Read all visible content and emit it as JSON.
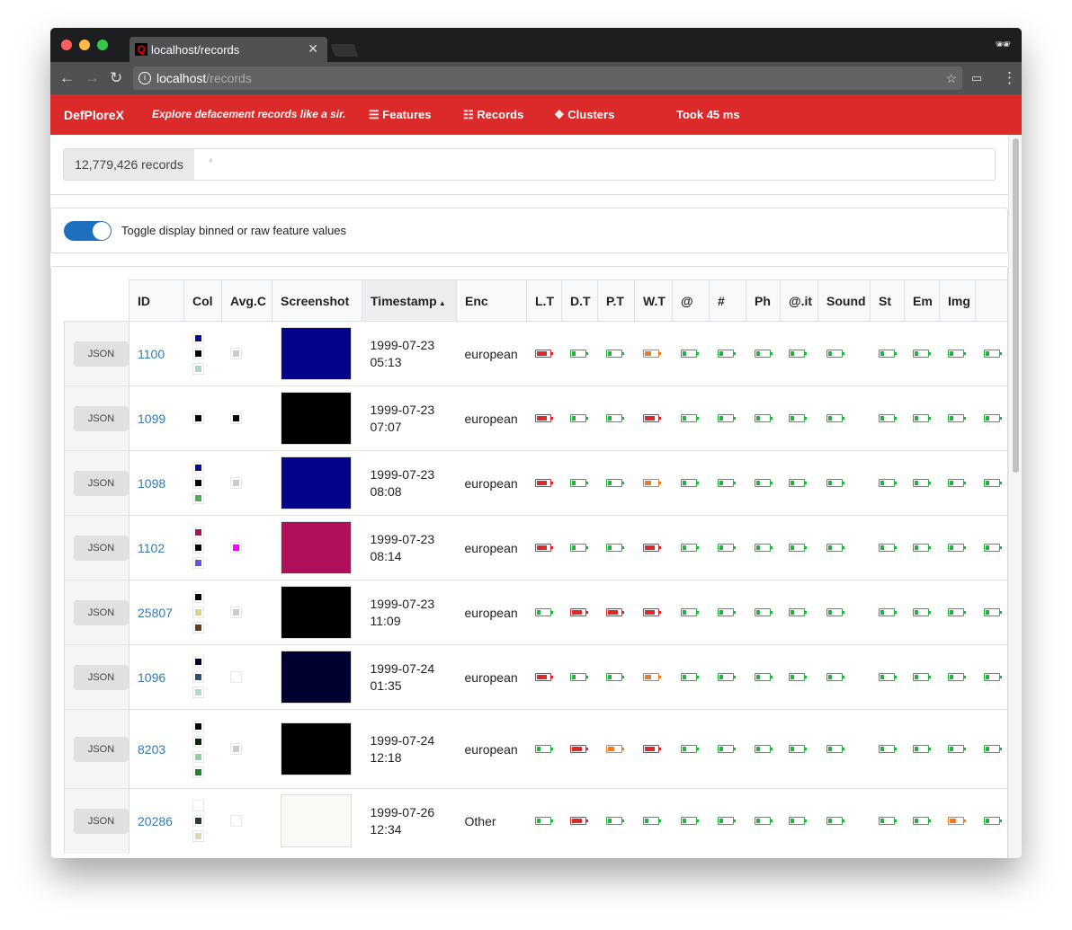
{
  "browser": {
    "tab_title": "localhost/records",
    "url_host": "localhost",
    "url_path": "/records"
  },
  "nav": {
    "brand": "DefPloreX",
    "tagline": "Explore defacement records like a sir.",
    "features": "Features",
    "records": "Records",
    "clusters": "Clusters",
    "took": "Took 45 ms"
  },
  "search": {
    "count": "12,779,426 records",
    "query": "*"
  },
  "toggle": {
    "label": "Toggle display binned or raw feature values",
    "on": true
  },
  "colors": {
    "accent": "#dc2a2a",
    "low": "#22b33c",
    "mid": "#f07a1e",
    "high": "#dc2a2a",
    "link": "#337ab7"
  },
  "table": {
    "headers": [
      "ID",
      "Col",
      "Avg.C",
      "Screenshot",
      "Timestamp",
      "Enc",
      "L.T",
      "D.T",
      "P.T",
      "W.T",
      "@",
      "#",
      "Ph",
      "@.it",
      "Sound",
      "St",
      "Em",
      "Img",
      ""
    ],
    "sorted_column": "Timestamp",
    "sort_direction": "ascending",
    "json_label": "JSON",
    "rows": [
      {
        "id": "1100",
        "colors": [
          "#0a0a8a",
          "#000000",
          "#a8d8c8"
        ],
        "avg": "#cccccc",
        "shot": "#04048a",
        "date": "1999-07-23",
        "time": "05:13",
        "enc": "european",
        "levels": [
          3,
          1,
          1,
          2,
          1,
          1,
          1,
          1,
          1,
          1,
          1,
          1,
          1
        ]
      },
      {
        "id": "1099",
        "colors": [
          "#000000"
        ],
        "avg": "#000000",
        "shot": "#000000",
        "date": "1999-07-23",
        "time": "07:07",
        "enc": "european",
        "levels": [
          3,
          1,
          1,
          3,
          1,
          1,
          1,
          1,
          1,
          1,
          1,
          1,
          1
        ]
      },
      {
        "id": "1098",
        "colors": [
          "#0a0a8a",
          "#000000",
          "#4caf50"
        ],
        "avg": "#cccccc",
        "shot": "#04048a",
        "date": "1999-07-23",
        "time": "08:08",
        "enc": "european",
        "levels": [
          3,
          1,
          1,
          2,
          1,
          1,
          1,
          1,
          1,
          1,
          1,
          1,
          1
        ]
      },
      {
        "id": "1102",
        "colors": [
          "#b0105a",
          "#000000",
          "#6a50e0"
        ],
        "avg": "#ff00ff",
        "shot": "#b0105a",
        "date": "1999-07-23",
        "time": "08:14",
        "enc": "european",
        "levels": [
          3,
          1,
          1,
          3,
          1,
          1,
          1,
          1,
          1,
          1,
          1,
          1,
          1
        ]
      },
      {
        "id": "25807",
        "colors": [
          "#000000",
          "#e0d090",
          "#6a3a1a"
        ],
        "avg": "#cccccc",
        "shot": "#000000",
        "date": "1999-07-23",
        "time": "11:09",
        "enc": "european",
        "levels": [
          1,
          3,
          3,
          3,
          1,
          1,
          1,
          1,
          1,
          1,
          1,
          1,
          1
        ]
      },
      {
        "id": "1096",
        "colors": [
          "#000030",
          "#305070",
          "#b0d8d0"
        ],
        "avg": "#ffffff",
        "shot": "#000030",
        "date": "1999-07-24",
        "time": "01:35",
        "enc": "european",
        "levels": [
          3,
          1,
          1,
          2,
          1,
          1,
          1,
          1,
          1,
          1,
          1,
          1,
          1
        ]
      },
      {
        "id": "8203",
        "colors": [
          "#000000",
          "#0a2a0a",
          "#90d0a0",
          "#2e7d32"
        ],
        "avg": "#cccccc",
        "shot": "#000000",
        "date": "1999-07-24",
        "time": "12:18",
        "enc": "european",
        "levels": [
          1,
          3,
          2,
          3,
          1,
          1,
          1,
          1,
          1,
          1,
          1,
          1,
          1
        ]
      },
      {
        "id": "20286",
        "colors": [
          "#ffffff",
          "#2a3a3a",
          "#e0d8b0"
        ],
        "avg": "#ffffff",
        "shot": "#fafaf5",
        "date": "1999-07-26",
        "time": "12:34",
        "enc": "Other",
        "levels": [
          1,
          3,
          1,
          1,
          1,
          1,
          1,
          1,
          1,
          1,
          1,
          2,
          1
        ]
      }
    ]
  }
}
